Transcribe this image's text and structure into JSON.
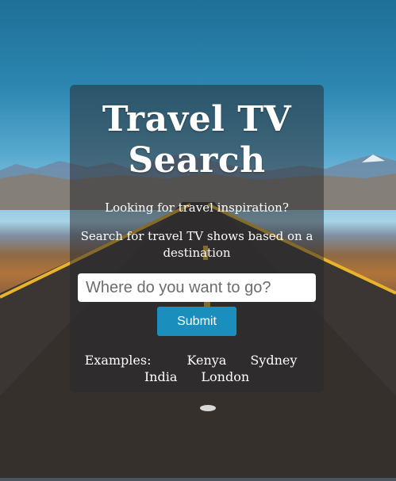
{
  "hero": {
    "title_line1": "Travel TV",
    "title_line2": "Search",
    "tagline": "Looking for travel inspiration?",
    "instructions": "Search for travel TV shows based on a destination"
  },
  "search": {
    "placeholder": "Where do you want to go?",
    "value": "",
    "submit_label": "Submit"
  },
  "examples": {
    "label": "Examples:",
    "items": [
      "Kenya",
      "Sydney",
      "India",
      "London"
    ]
  }
}
